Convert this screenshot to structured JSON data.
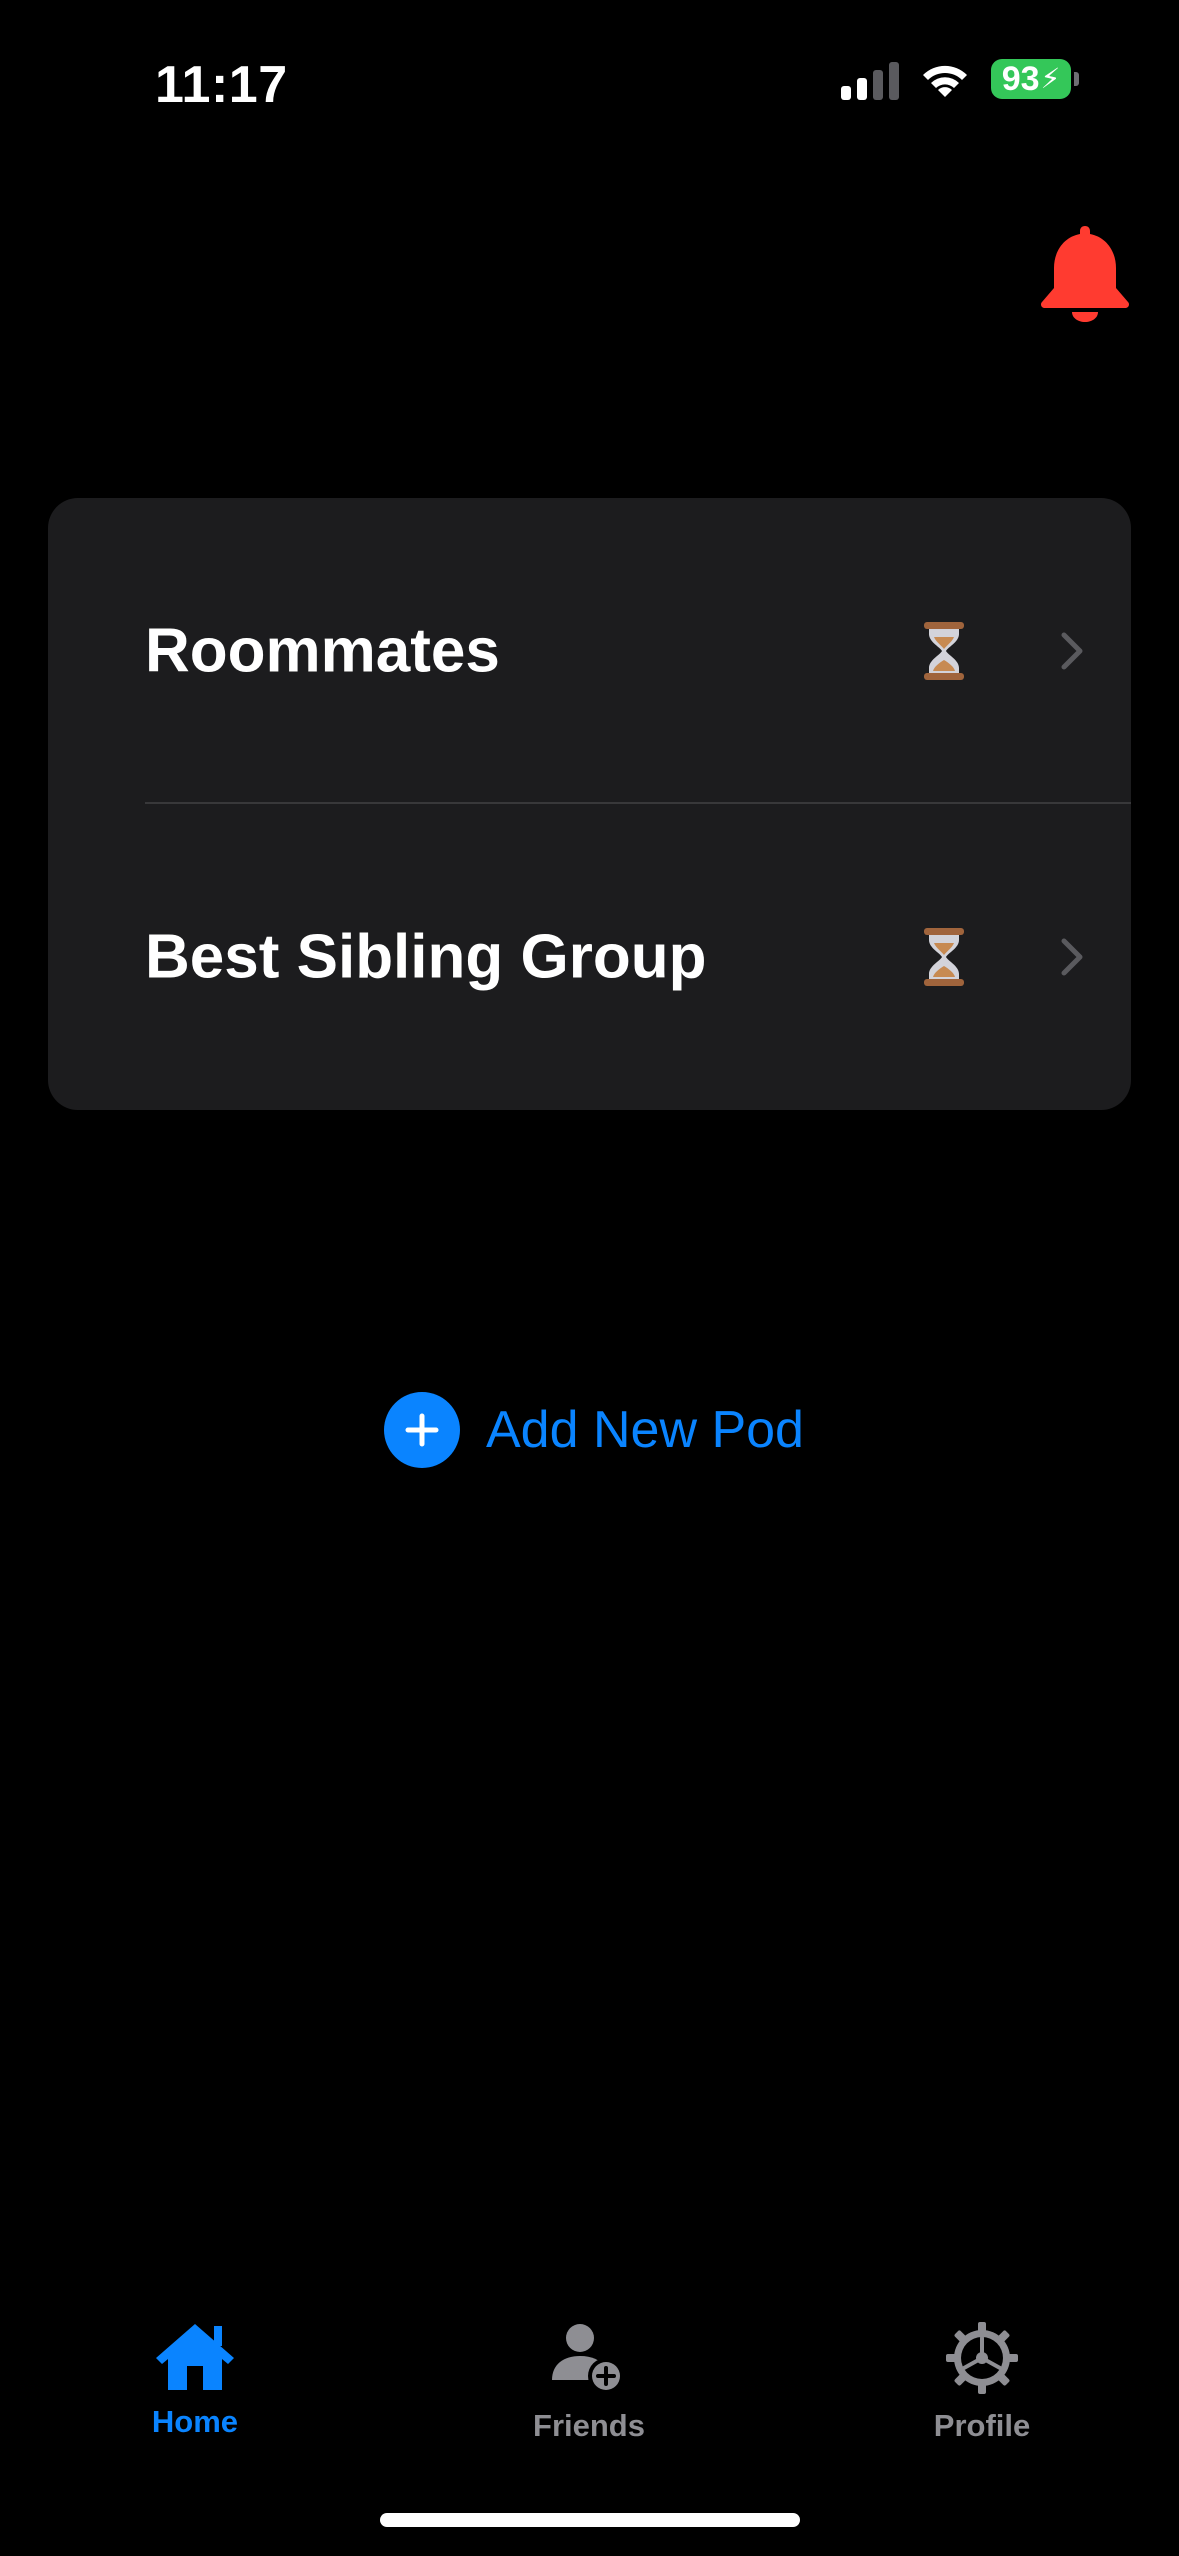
{
  "status_bar": {
    "time": "11:17",
    "battery_level": "93",
    "battery_charging": true,
    "signal_bars_active": 2,
    "signal_bars_total": 4
  },
  "header": {
    "notification_icon": "bell-icon"
  },
  "pods": [
    {
      "name": "Roommates",
      "status_icon": "hourglass-icon"
    },
    {
      "name": "Best Sibling Group",
      "status_icon": "hourglass-icon"
    }
  ],
  "add_pod": {
    "label": "Add New Pod",
    "icon": "plus-circle-icon"
  },
  "tab_bar": {
    "tabs": [
      {
        "label": "Home",
        "icon": "house-icon",
        "active": true
      },
      {
        "label": "Friends",
        "icon": "person-add-icon",
        "active": false
      },
      {
        "label": "Profile",
        "icon": "gear-icon",
        "active": false
      }
    ]
  },
  "colors": {
    "background": "#000000",
    "card": "#1c1c1e",
    "accent": "#0a84ff",
    "bell": "#ff3b30",
    "battery": "#34c759",
    "inactive_tab": "#8e8e93"
  }
}
